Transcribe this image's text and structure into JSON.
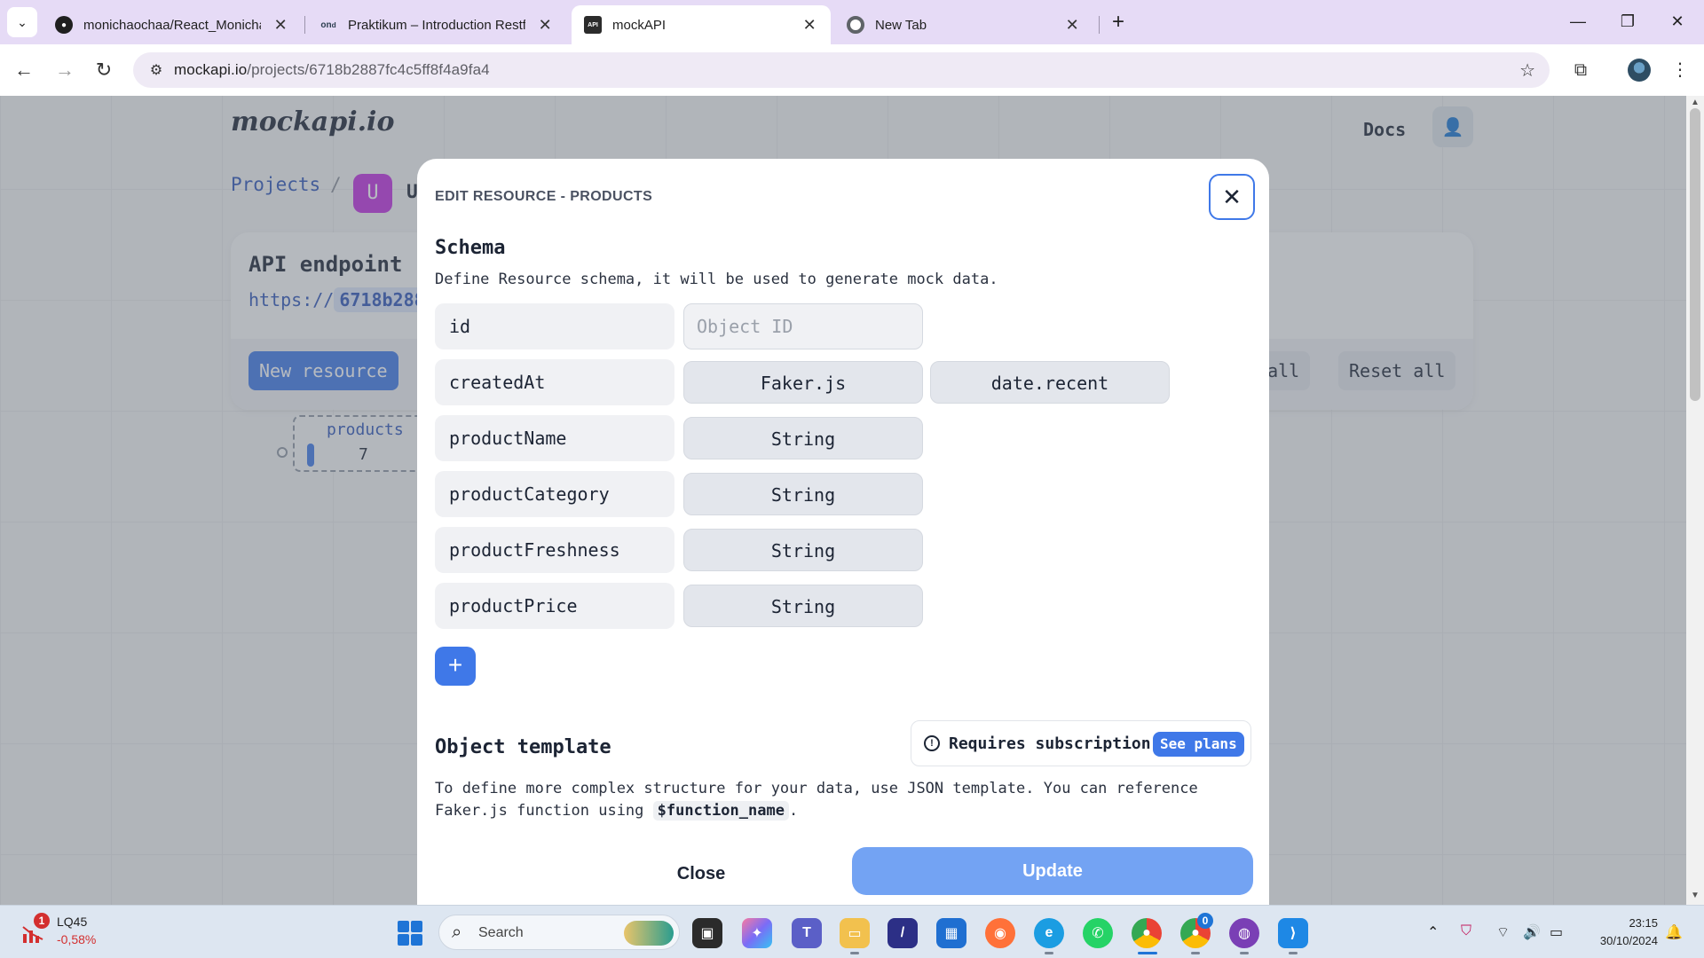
{
  "browser": {
    "tabs": [
      {
        "title": "monichaochaa/React_Monicha-",
        "icon": "github-icon",
        "active": false
      },
      {
        "title": "Praktikum – Introduction Restfu",
        "icon": "dicoding-icon",
        "active": false
      },
      {
        "title": "mockAPI",
        "icon": "mockapi-icon",
        "active": true
      },
      {
        "title": "New Tab",
        "icon": "chrome-icon",
        "active": false
      }
    ],
    "url_domain": "mockapi.io",
    "url_path": "/projects/6718b2887fc4c5ff8f4a9fa4"
  },
  "site": {
    "logo": "mockapi.io",
    "docs_label": "Docs",
    "breadcrumb_projects": "Projects",
    "breadcrumb_sep": "/",
    "project_initial": "U",
    "project_name_partial": "U",
    "api_endpoint_label": "API endpoint",
    "api_url_prefix": "https://",
    "api_url_id_partial": "6718b288",
    "new_resource_label": "New resource",
    "generate_all_partial": "e all",
    "reset_all_label": "Reset all",
    "resource_node": {
      "name": "products",
      "count": "7"
    }
  },
  "modal": {
    "heading": "EDIT RESOURCE - PRODUCTS",
    "schema_title": "Schema",
    "schema_desc": "Define Resource schema, it will be used to generate mock data.",
    "fields": [
      {
        "name": "id",
        "type_placeholder": "Object ID"
      },
      {
        "name": "createdAt",
        "type": "Faker.js",
        "method": "date.recent"
      },
      {
        "name": "productName",
        "type": "String"
      },
      {
        "name": "productCategory",
        "type": "String"
      },
      {
        "name": "productFreshness",
        "type": "String"
      },
      {
        "name": "productPrice",
        "type": "String"
      }
    ],
    "add_field_label": "+",
    "template_title": "Object template",
    "subscription_text": "Requires subscription",
    "see_plans_label": "See plans",
    "template_desc_1": "To define more complex structure for your data, use JSON template. You can reference",
    "template_desc_2": "Faker.js function using",
    "template_code": "$function_name",
    "template_desc_3": ".",
    "close_label": "Close",
    "update_label": "Update",
    "accent_color": "#3f78e8"
  },
  "taskbar": {
    "stock_badge": "1",
    "stock_name": "LQ45",
    "stock_change": "-0,58%",
    "search_label": "Search",
    "chrome_badge": "0",
    "time": "23:15",
    "date": "30/10/2024"
  }
}
